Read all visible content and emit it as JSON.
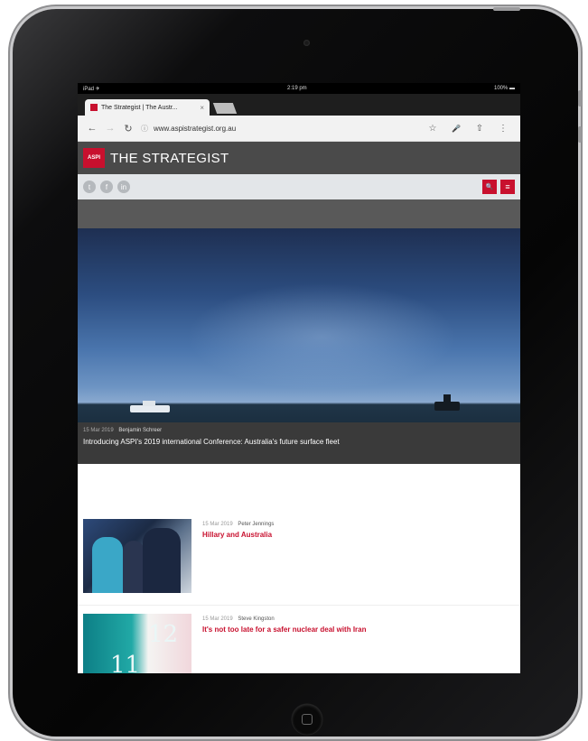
{
  "status": {
    "left": "iPad ✈",
    "time": "2:19 pm",
    "right": "100% ▬"
  },
  "browser": {
    "tab_title": "The Strategist | The Austr...",
    "tab_close": "×",
    "url": "www.aspistrategist.org.au",
    "back_icon": "←",
    "forward_icon": "→",
    "reload_icon": "↻",
    "lock_icon": "ⓘ",
    "star_icon": "☆",
    "mic_icon": "🎤",
    "share_icon": "⇧",
    "menu_icon": "⋮"
  },
  "site": {
    "logo_text": "ASPI",
    "title": "THE STRATEGIST",
    "social": [
      "t",
      "f",
      "in"
    ],
    "search_icon": "🔍",
    "menu_icon": "≡"
  },
  "hero": {
    "date": "15 Mar 2019",
    "author": "Benjamin Schreer",
    "title": "Introducing ASPI's 2019 international Conference: Australia's future surface fleet"
  },
  "articles": [
    {
      "date": "15 Mar 2019",
      "author": "Peter Jennings",
      "title": "Hillary and Australia"
    },
    {
      "date": "15 Mar 2019",
      "author": "Steve Kingston",
      "title": "It's not too late for a safer nuclear deal with Iran"
    }
  ],
  "thumb2_digits": [
    "11",
    "12"
  ]
}
